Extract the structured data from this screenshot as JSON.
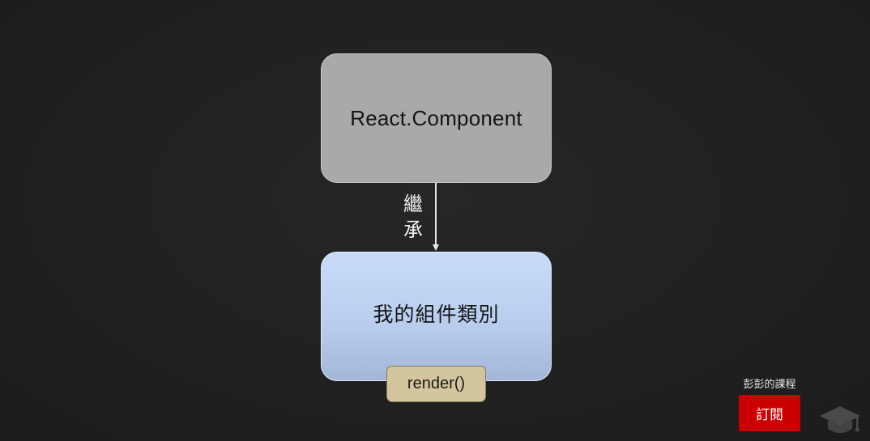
{
  "diagram": {
    "parent_node": {
      "label": "React.Component"
    },
    "edge": {
      "label_chars": [
        "繼",
        "承"
      ]
    },
    "child_node": {
      "label": "我的組件類別"
    },
    "method_tag": {
      "label": "render()"
    }
  },
  "overlay": {
    "channel_name": "彭彭的課程",
    "subscribe_label": "訂閱",
    "brand_icon": "graduation-cap-icon"
  },
  "colors": {
    "background": "#212121",
    "parent_fill": "#a9a9a9",
    "child_fill": "#c8dcfa",
    "method_fill": "#d3c59d",
    "subscribe_red": "#cc0000"
  }
}
